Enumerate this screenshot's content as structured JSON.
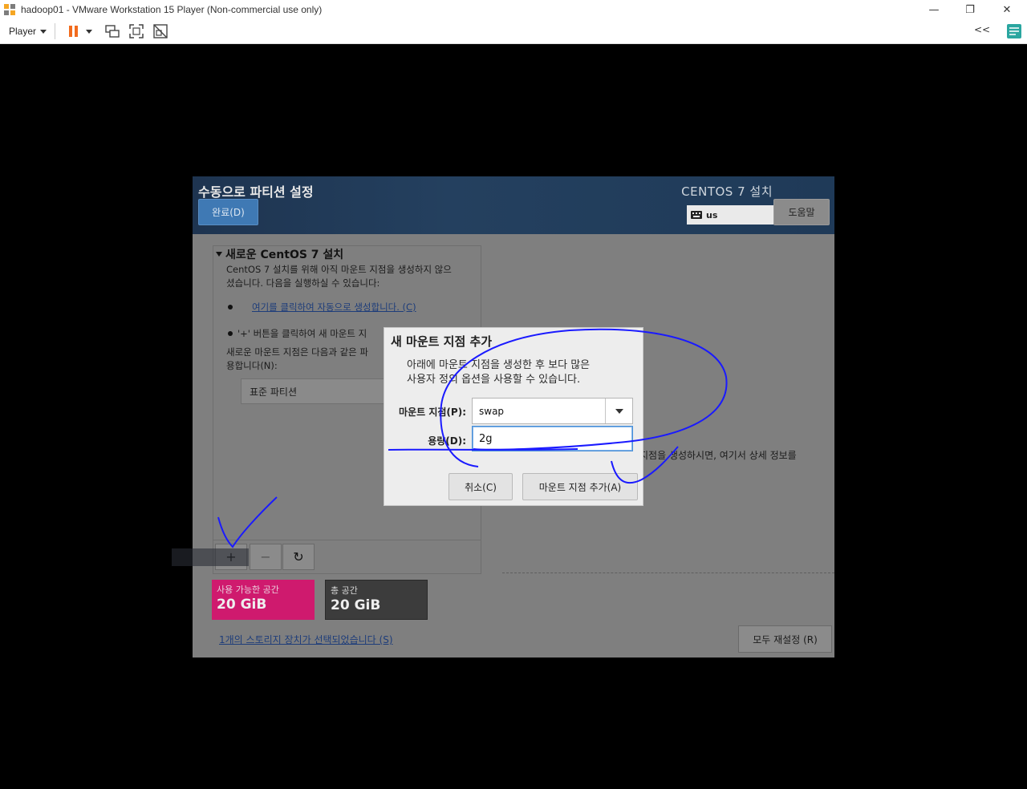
{
  "window": {
    "title": "hadoop01 - VMware Workstation 15 Player (Non-commercial use only)",
    "minimize_glyph": "—",
    "restore_glyph": "❐",
    "close_glyph": "✕"
  },
  "toolbar": {
    "player_label": "Player",
    "collapse_glyph": "<<"
  },
  "installer": {
    "title": "수동으로 파티션 설정",
    "done_button": "완료(D)",
    "product_title": "CENTOS 7 설치",
    "keyboard_layout": "us",
    "help_button": "도움말",
    "new_install": {
      "heading": "새로운 CentOS 7 설치",
      "intro_line1": "CentOS 7 설치를 위해 아직 마운트 지점을 생성하지 않으",
      "intro_line2": "셨습니다. 다음을 실행하실 수 있습니다:",
      "auto_create_link": "여기를 클릭하여 자동으로 생성합니다. (C)",
      "plus_hint": "'+' 버튼을 클릭하여 새 마운트 지",
      "scheme_line1": "새로운 마운트 지점은 다음과 같은 파",
      "scheme_line2": "용합니다(N):",
      "scheme_value": "표준 파티션"
    },
    "tool_buttons": {
      "add": "+",
      "remove": "−",
      "refresh": "↻"
    },
    "right_hint": "지점을 생성하시면, 여기서 상세 정보를",
    "available_space": {
      "label": "사용 가능한 공간",
      "value": "20 GiB",
      "color": "#cf1a6e"
    },
    "total_space": {
      "label": "총 공간",
      "value": "20 GiB",
      "color": "#3c3c3c"
    },
    "storage_link": "1개의 스토리지 장치가 선택되었습니다 (S)",
    "reset_button": "모두 재설정 (R)"
  },
  "dialog": {
    "title": "새 마운트 지점 추가",
    "desc_line1": "아래에 마운트 지점을 생성한 후 보다 많은",
    "desc_line2": "사용자 정의 옵션을 사용할 수 있습니다.",
    "mount_point_label": "마운트 지점(P):",
    "mount_point_value": "swap",
    "capacity_label": "용량(D):",
    "capacity_value": "2g",
    "cancel_button": "취소(C)",
    "add_button": "마운트 지점 추가(A)"
  },
  "colors": {
    "annotation_ink": "#1a1aff",
    "header_bg": "#1f3a58",
    "dim_overlay": "#7f7f7f"
  }
}
